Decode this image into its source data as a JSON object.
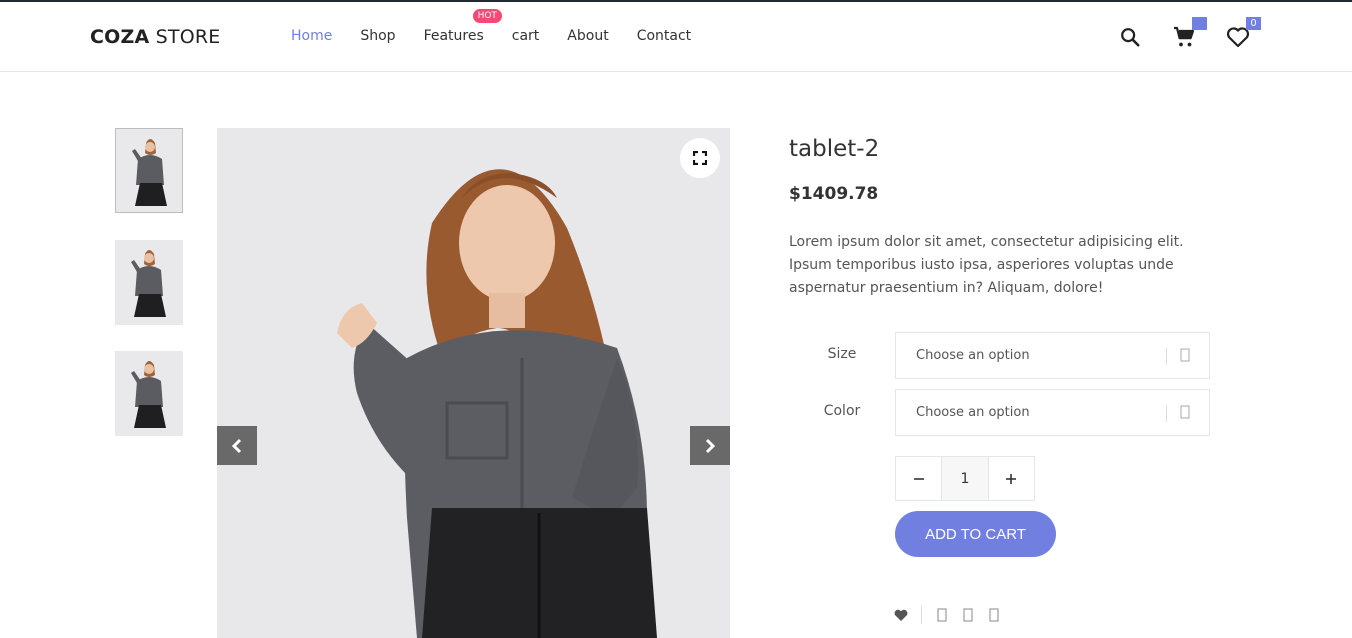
{
  "header": {
    "logo_bold": "COZA",
    "logo_light": " STORE",
    "nav": [
      {
        "label": "Home"
      },
      {
        "label": "Shop"
      },
      {
        "label": "Features",
        "badge": "HOT"
      },
      {
        "label": "cart"
      },
      {
        "label": "About"
      },
      {
        "label": "Contact"
      }
    ],
    "cart_count": "",
    "wishlist_count": "0"
  },
  "product": {
    "title": "tablet-2",
    "price": "$1409.78",
    "description": "Lorem ipsum dolor sit amet, consectetur adipisicing elit. Ipsum temporibus iusto ipsa, asperiores voluptas unde aspernatur praesentium in? Aliquam, dolore!",
    "size_label": "Size",
    "size_placeholder": "Choose an option",
    "color_label": "Color",
    "color_placeholder": "Choose an option",
    "quantity": "1",
    "add_to_cart": "ADD TO CART"
  },
  "colors": {
    "accent": "#717fe0",
    "hot_badge": "#f74877",
    "text": "#333333"
  },
  "icons": [
    "search-icon",
    "cart-icon",
    "heart-icon",
    "expand-icon",
    "chevron-left-icon",
    "chevron-right-icon",
    "minus-icon",
    "plus-icon"
  ]
}
